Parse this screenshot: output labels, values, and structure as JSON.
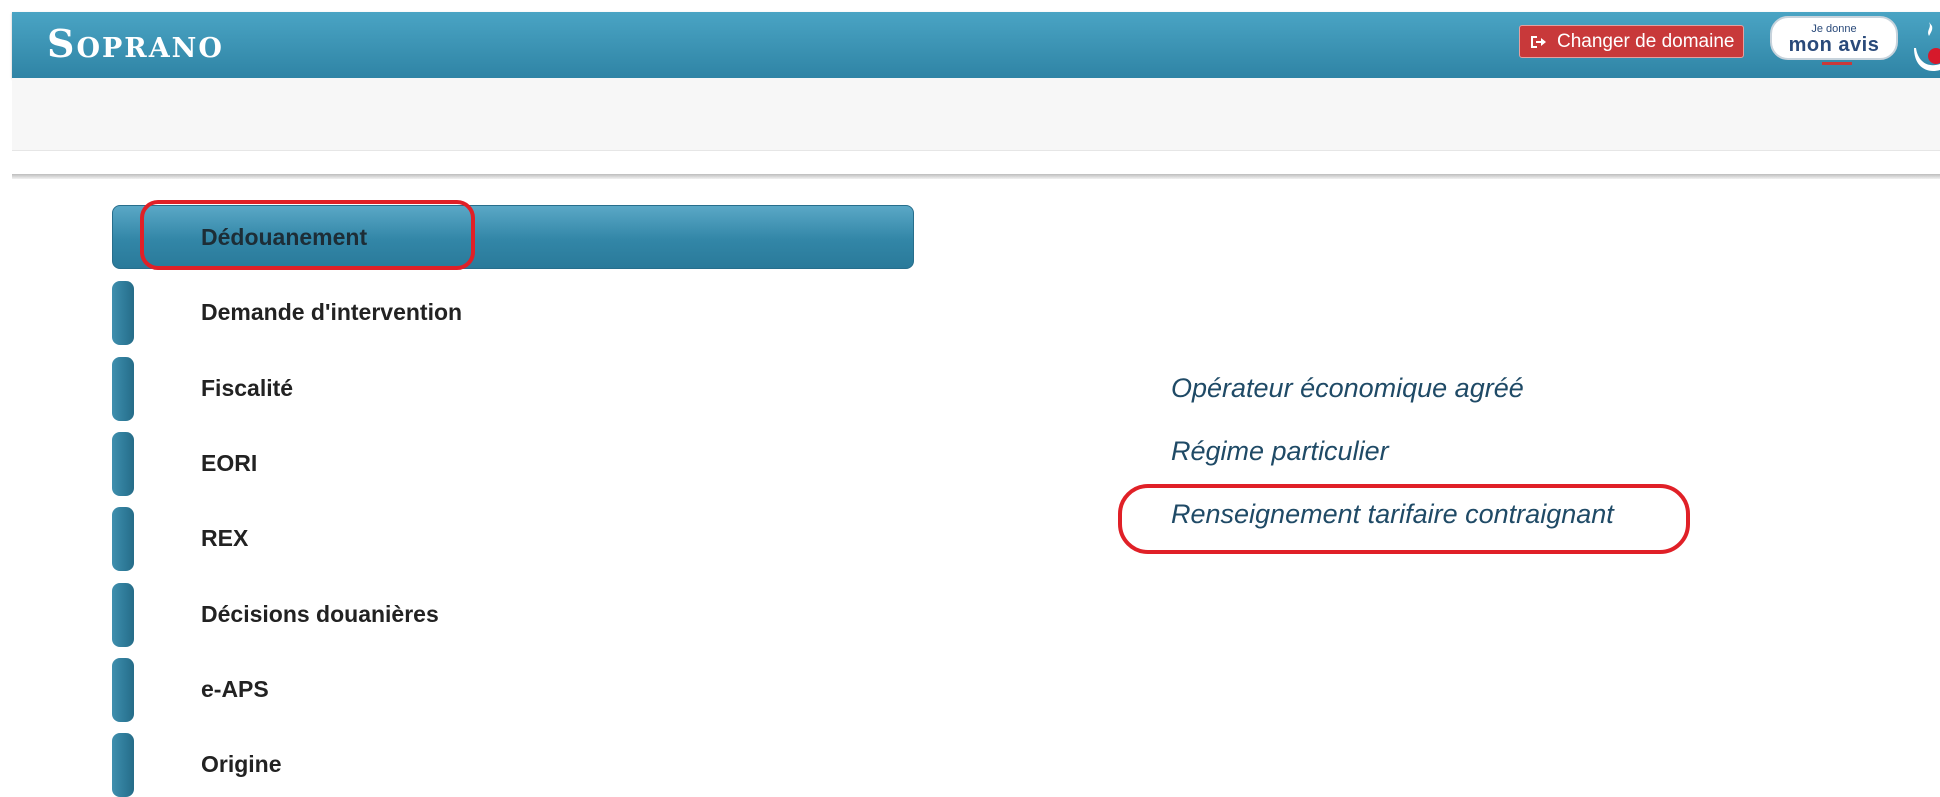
{
  "header": {
    "brand": "Soprano",
    "change_domain_label": "Changer de domaine",
    "avis_small": "Je donne",
    "avis_big": "mon avis",
    "icons": [
      "logout-icon",
      "flame-logo-icon"
    ],
    "colors": {
      "topbar": "#3a94b6",
      "change_domain": "#c8393a",
      "highlight": "#e02027"
    }
  },
  "menu": {
    "items": [
      {
        "label": "Dédouanement",
        "active": true
      },
      {
        "label": "Demande d'intervention"
      },
      {
        "label": "Fiscalité"
      },
      {
        "label": "EORI"
      },
      {
        "label": "REX"
      },
      {
        "label": "Décisions douanières"
      },
      {
        "label": "e-APS"
      },
      {
        "label": "Origine"
      }
    ]
  },
  "links": {
    "items": [
      {
        "label": "Opérateur économique agréé"
      },
      {
        "label": "Régime particulier"
      },
      {
        "label": "Renseignement tarifaire contraignant"
      }
    ]
  }
}
